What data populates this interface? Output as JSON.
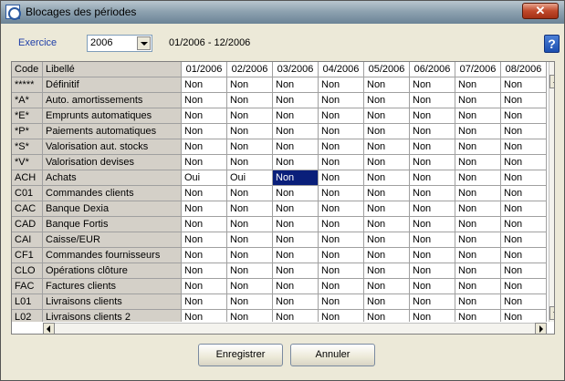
{
  "window": {
    "title": "Blocages des périodes",
    "close_label": "✕"
  },
  "exercice": {
    "label": "Exercice",
    "value": "2006",
    "range": "01/2006 - 12/2006"
  },
  "help": {
    "label": "?"
  },
  "grid": {
    "headers": [
      "Code",
      "Libellé",
      "01/2006",
      "02/2006",
      "03/2006",
      "04/2006",
      "05/2006",
      "06/2006",
      "07/2006",
      "08/2006"
    ],
    "rows": [
      [
        "*****",
        "Définitif",
        "Non",
        "Non",
        "Non",
        "Non",
        "Non",
        "Non",
        "Non",
        "Non"
      ],
      [
        "*A*",
        "Auto. amortissements",
        "Non",
        "Non",
        "Non",
        "Non",
        "Non",
        "Non",
        "Non",
        "Non"
      ],
      [
        "*E*",
        "Emprunts automatiques",
        "Non",
        "Non",
        "Non",
        "Non",
        "Non",
        "Non",
        "Non",
        "Non"
      ],
      [
        "*P*",
        "Paiements automatiques",
        "Non",
        "Non",
        "Non",
        "Non",
        "Non",
        "Non",
        "Non",
        "Non"
      ],
      [
        "*S*",
        "Valorisation aut. stocks",
        "Non",
        "Non",
        "Non",
        "Non",
        "Non",
        "Non",
        "Non",
        "Non"
      ],
      [
        "*V*",
        "Valorisation devises",
        "Non",
        "Non",
        "Non",
        "Non",
        "Non",
        "Non",
        "Non",
        "Non"
      ],
      [
        "ACH",
        "Achats",
        "Oui",
        "Oui",
        "Non",
        "Non",
        "Non",
        "Non",
        "Non",
        "Non"
      ],
      [
        "C01",
        "Commandes clients",
        "Non",
        "Non",
        "Non",
        "Non",
        "Non",
        "Non",
        "Non",
        "Non"
      ],
      [
        "CAC",
        "Banque Dexia",
        "Non",
        "Non",
        "Non",
        "Non",
        "Non",
        "Non",
        "Non",
        "Non"
      ],
      [
        "CAD",
        "Banque Fortis",
        "Non",
        "Non",
        "Non",
        "Non",
        "Non",
        "Non",
        "Non",
        "Non"
      ],
      [
        "CAI",
        "Caisse/EUR",
        "Non",
        "Non",
        "Non",
        "Non",
        "Non",
        "Non",
        "Non",
        "Non"
      ],
      [
        "CF1",
        "Commandes fournisseurs",
        "Non",
        "Non",
        "Non",
        "Non",
        "Non",
        "Non",
        "Non",
        "Non"
      ],
      [
        "CLO",
        "Opérations clôture",
        "Non",
        "Non",
        "Non",
        "Non",
        "Non",
        "Non",
        "Non",
        "Non"
      ],
      [
        "FAC",
        "Factures clients",
        "Non",
        "Non",
        "Non",
        "Non",
        "Non",
        "Non",
        "Non",
        "Non"
      ],
      [
        "L01",
        "Livraisons clients",
        "Non",
        "Non",
        "Non",
        "Non",
        "Non",
        "Non",
        "Non",
        "Non"
      ],
      [
        "L02",
        "Livraisons clients 2",
        "Non",
        "Non",
        "Non",
        "Non",
        "Non",
        "Non",
        "Non",
        "Non"
      ]
    ],
    "selected": {
      "row": 6,
      "col": 4
    }
  },
  "buttons": {
    "save": "Enregistrer",
    "cancel": "Annuler"
  },
  "colors": {
    "selection": "#0a1f7a",
    "fixed_col": "#d4d0c8"
  }
}
